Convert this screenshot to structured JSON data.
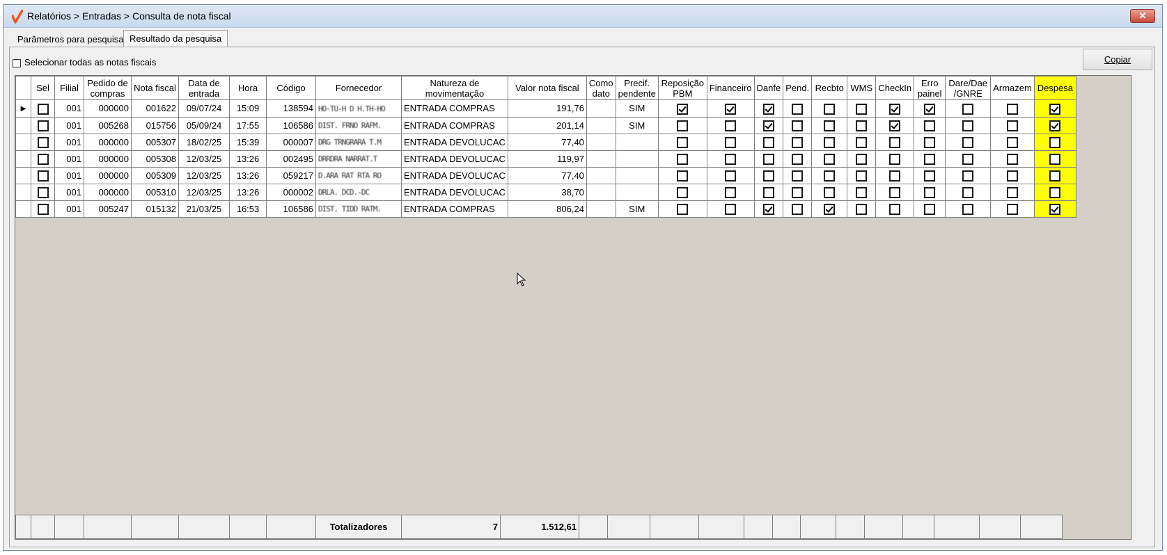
{
  "window": {
    "title": "Relatórios > Entradas > Consulta de nota fiscal",
    "close_label": "✕"
  },
  "tabs": [
    {
      "label": "Parâmetros para pesquisa",
      "active": false
    },
    {
      "label": "Resultado da pesquisa",
      "active": true
    }
  ],
  "select_all_label": "Selecionar todas as notas fiscais",
  "copy_button_label": "Copiar",
  "grid": {
    "columns": [
      "",
      "Sel",
      "Filial",
      "Pedido de compras",
      "Nota fiscal",
      "Data de entrada",
      "Hora",
      "Código",
      "Fornecedor",
      "Natureza de movimentação",
      "Valor nota fiscal",
      "Como dato",
      "Precif. pendente",
      "Reposição PBM",
      "Financeiro",
      "Danfe",
      "Pend.",
      "Recbto",
      "WMS",
      "CheckIn",
      "Erro painel",
      "Dare/Dae /GNRE",
      "Armazem",
      "Despesa"
    ],
    "highlight_column": "Despesa",
    "highlight_color": "#ffff00",
    "rows": [
      {
        "current": true,
        "filial": "001",
        "pedido": "000000",
        "nota": "001622",
        "data": "09/07/24",
        "hora": "15:09",
        "codigo": "138594",
        "fornecedor": "HO-TU-H D H.TH-HO",
        "natureza": "ENTRADA COMPRAS",
        "valor": "191,76",
        "precif": "SIM",
        "checks": [
          false,
          true,
          true,
          true,
          false,
          false,
          false,
          true,
          true,
          false,
          false,
          true
        ]
      },
      {
        "current": false,
        "filial": "001",
        "pedido": "005268",
        "nota": "015756",
        "data": "05/09/24",
        "hora": "17:55",
        "codigo": "106586",
        "fornecedor": "DIST. FRNO RAFM.",
        "natureza": "ENTRADA COMPRAS",
        "valor": "201,14",
        "precif": "SIM",
        "checks": [
          false,
          false,
          false,
          true,
          false,
          false,
          false,
          true,
          false,
          false,
          false,
          true
        ]
      },
      {
        "current": false,
        "filial": "001",
        "pedido": "000000",
        "nota": "005307",
        "data": "18/02/25",
        "hora": "15:39",
        "codigo": "000007",
        "fornecedor": "DRG TRNGRARA T.M",
        "natureza": "ENTRADA DEVOLUCAC",
        "valor": "77,40",
        "precif": "",
        "checks": [
          false,
          false,
          false,
          false,
          false,
          false,
          false,
          false,
          false,
          false,
          false,
          false
        ]
      },
      {
        "current": false,
        "filial": "001",
        "pedido": "000000",
        "nota": "005308",
        "data": "12/03/25",
        "hora": "13:26",
        "codigo": "002495",
        "fornecedor": "DRRDRA NARRAT.T",
        "natureza": "ENTRADA DEVOLUCAC",
        "valor": "119,97",
        "precif": "",
        "checks": [
          false,
          false,
          false,
          false,
          false,
          false,
          false,
          false,
          false,
          false,
          false,
          false
        ]
      },
      {
        "current": false,
        "filial": "001",
        "pedido": "000000",
        "nota": "005309",
        "data": "12/03/25",
        "hora": "13:26",
        "codigo": "059217",
        "fornecedor": "D.ARA RAT RTA RO",
        "natureza": "ENTRADA DEVOLUCAC",
        "valor": "77,40",
        "precif": "",
        "checks": [
          false,
          false,
          false,
          false,
          false,
          false,
          false,
          false,
          false,
          false,
          false,
          false
        ]
      },
      {
        "current": false,
        "filial": "001",
        "pedido": "000000",
        "nota": "005310",
        "data": "12/03/25",
        "hora": "13:26",
        "codigo": "000002",
        "fornecedor": "DRLA. DCD.-DC",
        "natureza": "ENTRADA DEVOLUCAC",
        "valor": "38,70",
        "precif": "",
        "checks": [
          false,
          false,
          false,
          false,
          false,
          false,
          false,
          false,
          false,
          false,
          false,
          false
        ]
      },
      {
        "current": false,
        "filial": "001",
        "pedido": "005247",
        "nota": "015132",
        "data": "21/03/25",
        "hora": "16:53",
        "codigo": "106586",
        "fornecedor": "DIST. TIDD RATM.",
        "natureza": "ENTRADA COMPRAS",
        "valor": "806,24",
        "precif": "SIM",
        "checks": [
          false,
          false,
          false,
          true,
          false,
          true,
          false,
          false,
          false,
          false,
          false,
          true
        ]
      }
    ]
  },
  "totals": {
    "label": "Totalizadores",
    "count": "7",
    "sum": "1.512,61"
  }
}
